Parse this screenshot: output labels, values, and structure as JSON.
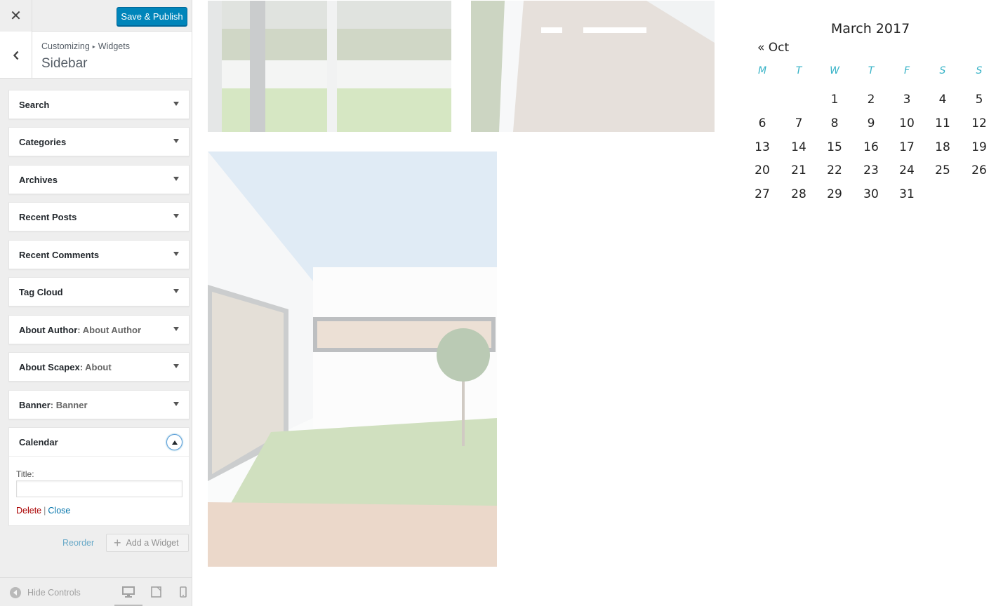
{
  "header": {
    "close_icon": "close-icon",
    "save_label": "Save & Publish"
  },
  "section": {
    "breadcrumb_root": "Customizing",
    "breadcrumb_separator": "▸",
    "breadcrumb_parent": "Widgets",
    "title": "Sidebar"
  },
  "widgets": [
    {
      "title": "Search",
      "instance": ""
    },
    {
      "title": "Categories",
      "instance": ""
    },
    {
      "title": "Archives",
      "instance": ""
    },
    {
      "title": "Recent Posts",
      "instance": ""
    },
    {
      "title": "Recent Comments",
      "instance": ""
    },
    {
      "title": "Tag Cloud",
      "instance": ""
    },
    {
      "title": "About Author",
      "instance": "About Author"
    },
    {
      "title": "About Scapex",
      "instance": "About"
    },
    {
      "title": "Banner",
      "instance": "Banner"
    }
  ],
  "calendar_widget": {
    "title": "Calendar",
    "field_label": "Title:",
    "field_value": "",
    "delete_label": "Delete",
    "separator": "|",
    "close_label": "Close"
  },
  "actions": {
    "reorder_label": "Reorder",
    "add_widget_label": "Add a Widget"
  },
  "footer": {
    "hide_controls_label": "Hide Controls",
    "devices": [
      "desktop",
      "tablet",
      "mobile"
    ]
  },
  "preview_calendar": {
    "caption": "March 2017",
    "prev_link": "« Oct",
    "weekdays": [
      "M",
      "T",
      "W",
      "T",
      "F",
      "S",
      "S"
    ],
    "weeks": [
      [
        "",
        "",
        "1",
        "2",
        "3",
        "4",
        "5"
      ],
      [
        "6",
        "7",
        "8",
        "9",
        "10",
        "11",
        "12"
      ],
      [
        "13",
        "14",
        "15",
        "16",
        "17",
        "18",
        "19"
      ],
      [
        "20",
        "21",
        "22",
        "23",
        "24",
        "25",
        "26"
      ],
      [
        "27",
        "28",
        "29",
        "30",
        "31",
        "",
        ""
      ]
    ],
    "accent_color": "#38b3c7"
  },
  "colors": {
    "primary_button": "#0085ba",
    "delete_link": "#aa0000",
    "link": "#0073aa"
  }
}
